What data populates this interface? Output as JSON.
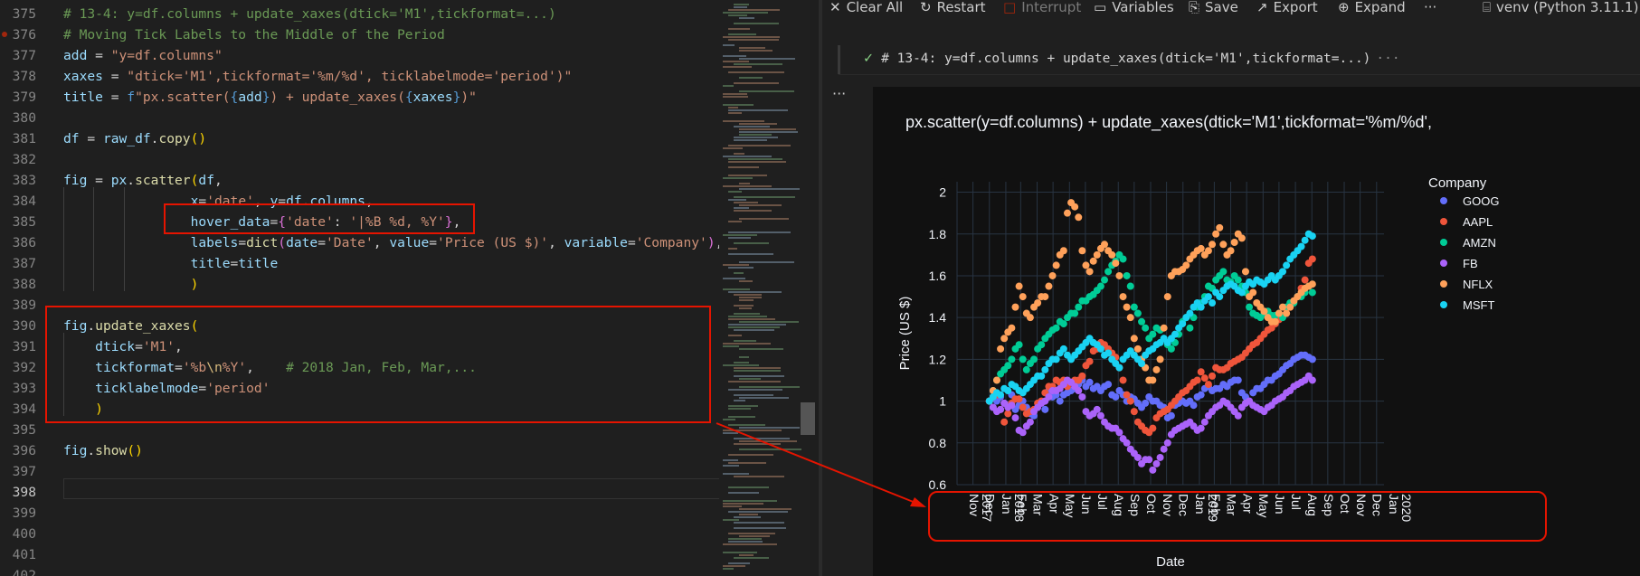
{
  "editor": {
    "lines": [
      {
        "n": "375",
        "code": "<span class=\"cmt\"># 13-4: y=df.columns + update_xaxes(dtick='M1',tickformat=...)</span>"
      },
      {
        "n": "376",
        "code": "<span class=\"cmt\"># Moving Tick Labels to the Middle of the Period</span>",
        "bp": true
      },
      {
        "n": "377",
        "code": "<span class=\"var\">add</span> = <span class=\"str\">\"y=df.columns\"</span>"
      },
      {
        "n": "378",
        "code": "<span class=\"var\">xaxes</span> = <span class=\"str\">\"dtick='M1',tickformat='%m/%d', ticklabelmode='period')\"</span>"
      },
      {
        "n": "379",
        "code": "<span class=\"var\">title</span> = <span class=\"kw\">f</span><span class=\"str\">\"px.scatter(</span><span class=\"kw\">{</span><span class=\"var\">add</span><span class=\"kw\">}</span><span class=\"str\">) + update_xaxes(</span><span class=\"kw\">{</span><span class=\"var\">xaxes</span><span class=\"kw\">}</span><span class=\"str\">)\"</span>"
      },
      {
        "n": "380",
        "code": ""
      },
      {
        "n": "381",
        "code": "<span class=\"var\">df</span> = <span class=\"var\">raw_df</span>.<span class=\"fn\">copy</span><span class=\"par\">()</span>"
      },
      {
        "n": "382",
        "code": ""
      },
      {
        "n": "383",
        "code": "<span class=\"var\">fig</span> = <span class=\"var\">px</span>.<span class=\"fn\">scatter</span><span class=\"par\">(</span><span class=\"var\">df</span>,"
      },
      {
        "n": "384",
        "code": "                <span class=\"var\">x</span>=<span class=\"str\">'date'</span>, <span class=\"var\">y</span>=<span class=\"var\">df</span>.<span class=\"var\">columns</span>,"
      },
      {
        "n": "385",
        "code": "                <span class=\"var\">hover_data</span>=<span class=\"par2\">{</span><span class=\"str\">'date'</span>: <span class=\"str\">'|%B %d, %Y'</span><span class=\"par2\">}</span>,"
      },
      {
        "n": "386",
        "code": "                <span class=\"var\">labels</span>=<span class=\"fn\">dict</span><span class=\"par2\">(</span><span class=\"var\">date</span>=<span class=\"str\">'Date'</span>, <span class=\"var\">value</span>=<span class=\"str\">'Price (US $)'</span>, <span class=\"var\">variable</span>=<span class=\"str\">'Company'</span><span class=\"par2\">)</span>,"
      },
      {
        "n": "387",
        "code": "                <span class=\"var\">title</span>=<span class=\"var\">title</span>"
      },
      {
        "n": "388",
        "code": "                <span class=\"par\">)</span>"
      },
      {
        "n": "389",
        "code": ""
      },
      {
        "n": "390",
        "code": "<span class=\"var\">fig</span>.<span class=\"fn\">update_xaxes</span><span class=\"par\">(</span>"
      },
      {
        "n": "391",
        "code": "    <span class=\"var\">dtick</span>=<span class=\"str\">'M1'</span>,"
      },
      {
        "n": "392",
        "code": "    <span class=\"var\">tickformat</span>=<span class=\"str\">'%b</span><span class=\"esc\">\\n</span><span class=\"str\">%Y'</span>,    <span class=\"cmt\"># 2018 Jan, Feb, Mar,...</span>"
      },
      {
        "n": "393",
        "code": "    <span class=\"var\">ticklabelmode</span>=<span class=\"str\">'period'</span>"
      },
      {
        "n": "394",
        "code": "    <span class=\"par\">)</span>"
      },
      {
        "n": "395",
        "code": ""
      },
      {
        "n": "396",
        "code": "<span class=\"var\">fig</span>.<span class=\"fn\">show</span><span class=\"par\">()</span>"
      },
      {
        "n": "397",
        "code": ""
      },
      {
        "n": "398",
        "code": "",
        "current": true
      },
      {
        "n": "399",
        "code": ""
      },
      {
        "n": "400",
        "code": ""
      },
      {
        "n": "401",
        "code": ""
      },
      {
        "n": "402",
        "code": ""
      }
    ]
  },
  "toolbar": {
    "clear_all": "Clear All",
    "restart": "Restart",
    "interrupt": "Interrupt",
    "variables": "Variables",
    "save": "Save",
    "export": "Export",
    "expand": "Expand",
    "more": "···",
    "kernel": "venv (Python 3.11.1)"
  },
  "cell": {
    "header": "# 13-4: y=df.columns + update_xaxes(dtick='M1',tickformat=...)",
    "collapsed_marker": "···",
    "more": "···"
  },
  "chart_data": {
    "type": "scatter",
    "title": "px.scatter(y=df.columns) + update_xaxes(dtick='M1',tickformat='%m/%d',",
    "xlabel": "Date",
    "ylabel": "Price (US $)",
    "legend_title": "Company",
    "legend_position": "top-right",
    "ylim": [
      0.6,
      2.05
    ],
    "yticks": [
      0.6,
      0.8,
      1,
      1.2,
      1.4,
      1.6,
      1.8,
      2
    ],
    "xticks": [
      "Nov\n2017",
      "Dec",
      "Jan\n2018",
      "Feb",
      "Mar",
      "Apr",
      "May",
      "Jun",
      "Jul",
      "Aug",
      "Sep",
      "Oct",
      "Nov",
      "Dec",
      "Jan\n2019",
      "Feb",
      "Mar",
      "Apr",
      "May",
      "Jun",
      "Jul",
      "Aug",
      "Sep",
      "Oct",
      "Nov",
      "Dec",
      "Jan\n2020"
    ],
    "x_start": "2018-01-01",
    "x_step_days": 7,
    "series": [
      {
        "name": "GOOG",
        "color": "#636efa",
        "values": [
          1,
          0.97,
          1,
          1.02,
          0.99,
          0.98,
          1.03,
          0.96,
          0.98,
          1,
          0.97,
          0.94,
          0.93,
          0.97,
          0.99,
          0.96,
          1.05,
          1.02,
          1.03,
          1,
          1.03,
          1.04,
          1.05,
          1.06,
          1.08,
          1.1,
          1.07,
          1.09,
          1.06,
          1.07,
          1.05,
          1.07,
          1.08,
          1.03,
          1.02,
          1.05,
          1.03,
          1,
          1.02,
          1.01,
          0.99,
          0.97,
          0.99,
          1.02,
          1,
          1,
          0.98,
          0.97,
          0.92,
          0.93,
          0.98,
          0.99,
          1,
          0.99,
          1,
          0.98,
          1.02,
          1.03,
          1.06,
          1.07,
          1.05,
          1.06,
          1.06,
          1.08,
          1.07,
          1.09,
          1.1,
          1.1,
          1.04,
          1.02,
          1,
          1.04,
          1.06,
          1.06,
          1.08,
          1.1,
          1.1,
          1.12,
          1.13,
          1.15,
          1.17,
          1.18,
          1.2,
          1.21,
          1.22,
          1.22,
          1.21,
          1.2
        ]
      },
      {
        "name": "AAPL",
        "color": "#ef553b",
        "values": [
          1,
          1.02,
          1.03,
          0.96,
          0.9,
          0.94,
          0.99,
          1.01,
          1.01,
          0.97,
          0.94,
          0.95,
          0.96,
          0.99,
          1,
          1.04,
          1.07,
          1.07,
          1.1,
          1.09,
          1.1,
          1.07,
          1.09,
          1.1,
          1.1,
          1.12,
          1.17,
          1.19,
          1.24,
          1.25,
          1.28,
          1.27,
          1.25,
          1.23,
          1.21,
          1.16,
          1.1,
          1.03,
          1,
          0.95,
          0.9,
          0.88,
          0.86,
          0.85,
          0.87,
          0.92,
          0.94,
          0.95,
          0.96,
          0.98,
          1,
          1.02,
          1.04,
          1.05,
          1.07,
          1.09,
          1.1,
          1.14,
          1.11,
          1.08,
          1.12,
          1.16,
          1.15,
          1.15,
          1.16,
          1.18,
          1.19,
          1.2,
          1.21,
          1.23,
          1.25,
          1.27,
          1.28,
          1.3,
          1.32,
          1.34,
          1.35,
          1.37,
          1.39,
          1.41,
          1.42,
          1.45,
          1.48,
          1.5,
          1.54,
          1.58,
          1.66,
          1.68
        ]
      },
      {
        "name": "AMZN",
        "color": "#00cc96",
        "values": [
          1,
          1.05,
          1.1,
          1.13,
          1.15,
          1.17,
          1.2,
          1.25,
          1.27,
          1.2,
          1.15,
          1.18,
          1.2,
          1.25,
          1.27,
          1.3,
          1.32,
          1.34,
          1.35,
          1.38,
          1.37,
          1.4,
          1.42,
          1.42,
          1.45,
          1.48,
          1.48,
          1.5,
          1.51,
          1.53,
          1.55,
          1.58,
          1.62,
          1.65,
          1.67,
          1.7,
          1.68,
          1.6,
          1.55,
          1.45,
          1.42,
          1.38,
          1.35,
          1.3,
          1.32,
          1.35,
          1.34,
          1.3,
          1.27,
          1.25,
          1.28,
          1.32,
          1.38,
          1.4,
          1.35,
          1.4,
          1.45,
          1.47,
          1.5,
          1.55,
          1.54,
          1.58,
          1.6,
          1.62,
          1.58,
          1.57,
          1.6,
          1.58,
          1.55,
          1.52,
          1.45,
          1.42,
          1.41,
          1.4,
          1.42,
          1.43,
          1.41,
          1.41,
          1.42,
          1.4,
          1.45,
          1.47,
          1.47,
          1.5,
          1.5,
          1.52,
          1.55,
          1.52
        ]
      },
      {
        "name": "FB",
        "color": "#ab63fa",
        "values": [
          1,
          0.97,
          0.95,
          0.96,
          0.99,
          0.97,
          0.98,
          0.92,
          0.86,
          0.85,
          0.88,
          0.9,
          0.95,
          0.97,
          0.99,
          1,
          1.02,
          1.05,
          1.05,
          1.06,
          1.08,
          1.1,
          1.09,
          1.07,
          1.05,
          1.02,
          0.95,
          0.93,
          0.94,
          0.96,
          0.93,
          0.9,
          0.88,
          0.87,
          0.87,
          0.85,
          0.82,
          0.8,
          0.77,
          0.75,
          0.73,
          0.7,
          0.72,
          0.72,
          0.67,
          0.7,
          0.73,
          0.77,
          0.8,
          0.84,
          0.86,
          0.87,
          0.88,
          0.89,
          0.9,
          0.88,
          0.86,
          0.87,
          0.9,
          0.93,
          0.95,
          0.97,
          0.98,
          1,
          0.99,
          0.97,
          0.95,
          0.93,
          0.97,
          0.99,
          1,
          0.98,
          0.97,
          0.96,
          0.95,
          0.97,
          0.98,
          1,
          1.01,
          1.02,
          1.04,
          1.05,
          1.07,
          1.08,
          1.09,
          1.1,
          1.12,
          1.1
        ]
      },
      {
        "name": "NFLX",
        "color": "#ffa15a",
        "values": [
          1,
          1.05,
          1.1,
          1.25,
          1.3,
          1.33,
          1.35,
          1.45,
          1.55,
          1.5,
          1.42,
          1.4,
          1.45,
          1.47,
          1.5,
          1.5,
          1.55,
          1.6,
          1.65,
          1.7,
          1.72,
          1.9,
          1.95,
          1.93,
          1.88,
          1.72,
          1.65,
          1.62,
          1.67,
          1.7,
          1.73,
          1.75,
          1.72,
          1.7,
          1.66,
          1.6,
          1.5,
          1.45,
          1.4,
          1.3,
          1.25,
          1.2,
          1.16,
          1.1,
          1.1,
          1.15,
          1.2,
          1.35,
          1.5,
          1.6,
          1.62,
          1.62,
          1.63,
          1.65,
          1.68,
          1.7,
          1.72,
          1.73,
          1.7,
          1.72,
          1.75,
          1.8,
          1.83,
          1.75,
          1.7,
          1.72,
          1.76,
          1.8,
          1.78,
          1.62,
          1.5,
          1.52,
          1.47,
          1.45,
          1.43,
          1.4,
          1.38,
          1.38,
          1.42,
          1.45,
          1.42,
          1.45,
          1.48,
          1.5,
          1.52,
          1.54,
          1.55,
          1.56
        ]
      },
      {
        "name": "MSFT",
        "color": "#19d3f3",
        "values": [
          1,
          1.02,
          1.04,
          1.03,
          1.06,
          1.05,
          1.08,
          1.07,
          1.05,
          1.04,
          1.06,
          1.08,
          1.1,
          1.12,
          1.12,
          1.15,
          1.18,
          1.2,
          1.2,
          1.23,
          1.25,
          1.22,
          1.2,
          1.22,
          1.24,
          1.26,
          1.28,
          1.3,
          1.28,
          1.27,
          1.25,
          1.22,
          1.23,
          1.2,
          1.18,
          1.16,
          1.2,
          1.22,
          1.24,
          1.22,
          1.2,
          1.18,
          1.22,
          1.24,
          1.25,
          1.27,
          1.28,
          1.3,
          1.28,
          1.3,
          1.32,
          1.35,
          1.37,
          1.4,
          1.42,
          1.45,
          1.47,
          1.45,
          1.48,
          1.5,
          1.47,
          1.52,
          1.5,
          1.53,
          1.55,
          1.56,
          1.55,
          1.53,
          1.52,
          1.55,
          1.57,
          1.56,
          1.58,
          1.57,
          1.56,
          1.58,
          1.6,
          1.58,
          1.6,
          1.62,
          1.65,
          1.68,
          1.7,
          1.72,
          1.74,
          1.77,
          1.8,
          1.79
        ]
      }
    ]
  }
}
